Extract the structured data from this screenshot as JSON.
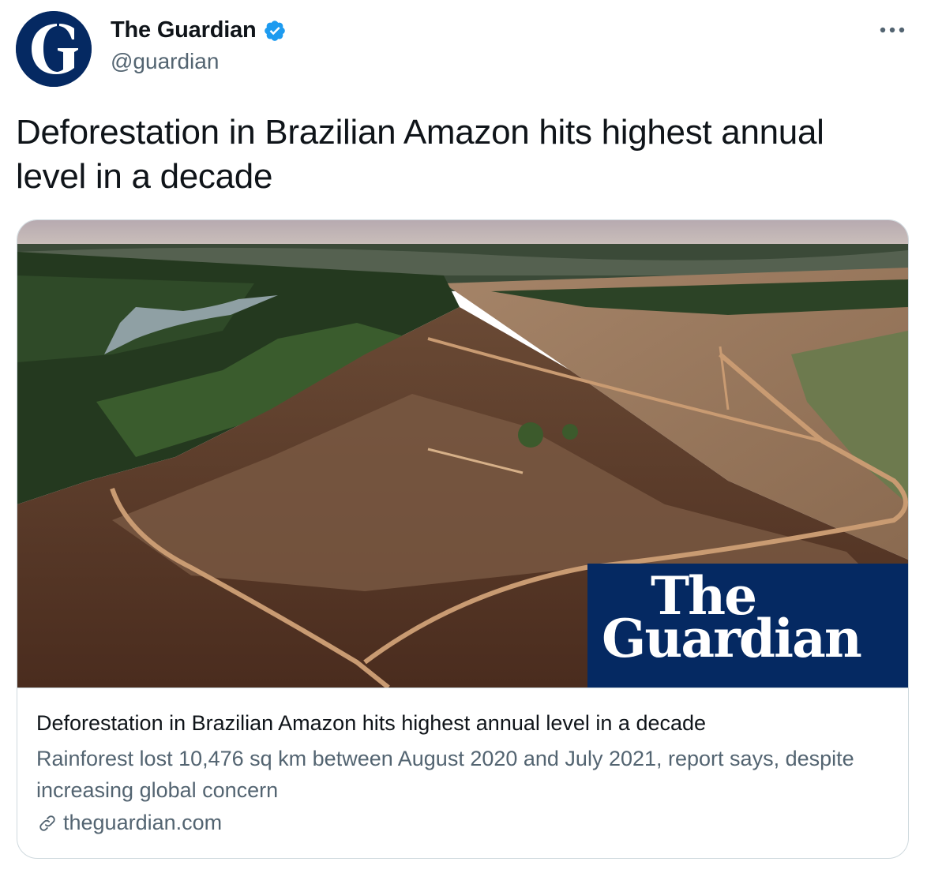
{
  "tweet": {
    "author": {
      "display_name": "The Guardian",
      "handle": "@guardian",
      "verified": true,
      "avatar_letter": "G",
      "avatar_color": "#052962"
    },
    "more_icon": "ellipsis-icon",
    "text": "Deforestation in Brazilian Amazon hits highest annual level in a decade"
  },
  "card": {
    "image_wordmark_line1": "The",
    "image_wordmark_line2": "Guardian",
    "title": "Deforestation in Brazilian Amazon hits highest annual level in a decade",
    "description": "Rainforest lost 10,476 sq km between August 2020 and July 2021, report says, despite increasing global concern",
    "domain": "theguardian.com",
    "domain_icon": "link-icon"
  },
  "colors": {
    "text_primary": "#0f1419",
    "text_secondary": "#536471",
    "border": "#cfd9de",
    "verified_blue": "#1d9bf0",
    "brand_navy": "#052962"
  }
}
